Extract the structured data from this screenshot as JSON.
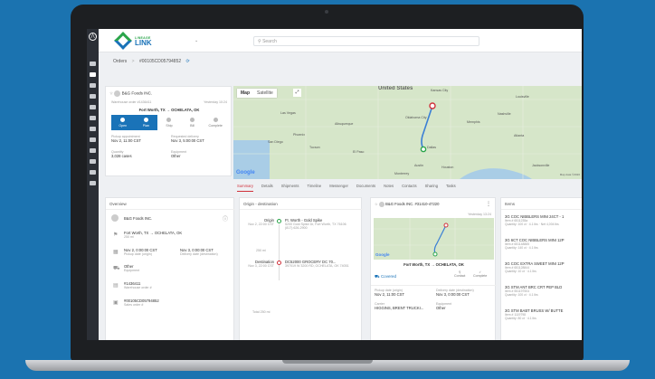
{
  "brand": {
    "small": "LINEAGE",
    "big": "LINK"
  },
  "search": {
    "placeholder": "Search"
  },
  "breadcrumb": {
    "root": "Orders",
    "sep": ">",
    "order": "#00105CD05794852"
  },
  "header_card": {
    "company": "B&G Foods INC.",
    "warehouse_order": "Warehouse order #1436411",
    "date": "Yesterday 10:24",
    "origin": "Fort Worth, TX",
    "destination": "OCHELATA, OK",
    "steps": [
      "Open",
      "Plan",
      "Ship",
      "Bill",
      "Complete"
    ],
    "pickup_label": "Pickup appointment",
    "pickup_value": "Nov 2, 11:00 CST",
    "delivery_label": "Requested delivery",
    "delivery_value": "Nov 3, 5:00:00 CST",
    "quantity_label": "Quantity",
    "quantity_value": "3,028 cases",
    "equipment_label": "Equipment",
    "equipment_value": "Other"
  },
  "map": {
    "tab_map": "Map",
    "tab_satellite": "Satellite",
    "country": "United States",
    "cities": [
      "Kansas City",
      "Louisville",
      "Las Vegas",
      "Oklahoma City",
      "Nashville",
      "Albuquerque",
      "Memphis",
      "Phoenix",
      "Atlanta",
      "San Diego",
      "Dallas",
      "Tucson",
      "El Paso",
      "Austin",
      "Houston",
      "Jacksonville",
      "Monterrey"
    ],
    "footer": "Map data ©2020",
    "google": "Google"
  },
  "tabs": [
    "Summary",
    "Details",
    "Shipments",
    "Timeline",
    "Messenger",
    "Documents",
    "Notes",
    "Contacts",
    "Sharing",
    "Tasks"
  ],
  "overview": {
    "title": "Overview",
    "company": "B&G Foods INC.",
    "route": "Fort Worth, TX → OCHELATA, OK",
    "route_sub": "250 mi",
    "pickup": "Nov 2, 0:00:00 CST",
    "pickup_sub": "Pickup date (origin)",
    "delivery": "Nov 3, 0:00:00 CST",
    "delivery_sub": "Delivery date (destination)",
    "equipment": "Other",
    "equipment_sub": "Equipment",
    "warehouse": "#1436411",
    "warehouse_sub": "Warehouse order #",
    "order": "#00105CD05794852",
    "order_sub": "Sales order #"
  },
  "od": {
    "title": "Origin - destination",
    "origin_label": "Origin",
    "origin_date": "Nov 2, 22:00 CST",
    "origin_name": "Ft. Worth - Gold Spike",
    "origin_addr": "5200 Gold Spike Dr, Fort Worth, TX 76106",
    "origin_phone": "(817) 626-2900",
    "distance": "250 mi",
    "dest_label": "Destination",
    "dest_date": "Nov 3, 22:00 CST",
    "dest_name": "DC52000 GROCERY DC 70...",
    "dest_addr": "397019 W 3200 RD, OCHELATA, OK 74051",
    "total": "Total 250 mi"
  },
  "shipment": {
    "company": "B&G Foods INC. #31410-47220",
    "date": "Yesterday 13:24",
    "route": "Fort Worth, TX → OCHELATA, OK",
    "status": "Covered",
    "act1": "Contact",
    "act2": "Complete",
    "pickup_label": "Pickup date (origin)",
    "pickup_value": "Nov 2, 11:00 CST",
    "delivery_label": "Delivery date (destination)",
    "delivery_value": "Nov 3, 0:00:00 CST",
    "carrier_label": "Carrier",
    "carrier_value": "HIGGINS, BRENT TRUCKI...",
    "equipment_label": "Equipment",
    "equipment_value": "Other"
  },
  "items": {
    "title": "Items",
    "list": [
      {
        "name": "3G COC NIBBLERS MINI 24CT - 1",
        "sub": "Item # 6511235a",
        "meta": "Quantity: 100 ct · 4.1 lbs · Net 4,004 lbs"
      },
      {
        "name": "3G 6CT COC NIBBLERS MINI 12P",
        "sub": "Item # 651148885",
        "meta": "Quantity: 140 ct · 4.1 lbs"
      },
      {
        "name": "3G COC EXTRA SWEET MINI 12P",
        "sub": "Item # 651128844",
        "meta": "Quantity: 10 ct · 4.1 lbs"
      },
      {
        "name": "3G STM ANT BRC CRT PEP BLD",
        "sub": "Item # 551197504",
        "meta": "Quantity: 100 ct · 4.1 lbs"
      },
      {
        "name": "3G STM BABT BRUSS W/ BUTTE",
        "sub": "Item # 1119798",
        "meta": "Quantity: 80 ct · 4.1 lbs"
      }
    ]
  }
}
